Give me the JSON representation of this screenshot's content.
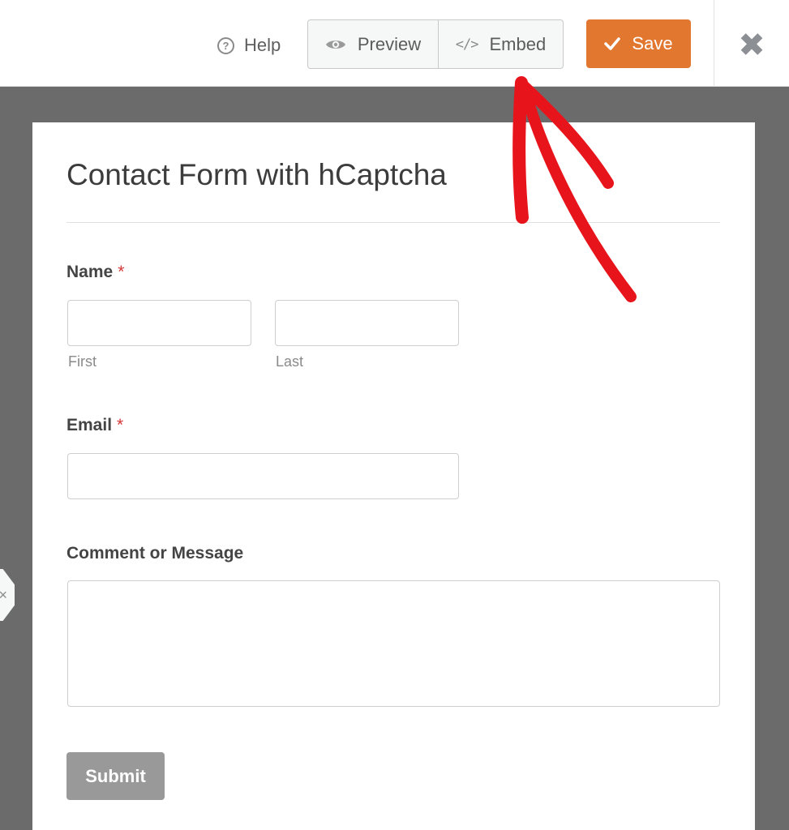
{
  "toolbar": {
    "help_label": "Help",
    "preview_label": "Preview",
    "embed_label": "Embed",
    "save_label": "Save",
    "close_icon": "✖",
    "accent_color": "#e27730"
  },
  "side_tab": {
    "icon": "×"
  },
  "form": {
    "title": "Contact Form with hCaptcha",
    "fields": {
      "name": {
        "label": "Name",
        "required_mark": "*",
        "first_sublabel": "First",
        "last_sublabel": "Last"
      },
      "email": {
        "label": "Email",
        "required_mark": "*"
      },
      "message": {
        "label": "Comment or Message"
      }
    },
    "submit_label": "Submit"
  },
  "annotation": {
    "color": "#e8141b",
    "icon": "hand-drawn-arrow"
  }
}
